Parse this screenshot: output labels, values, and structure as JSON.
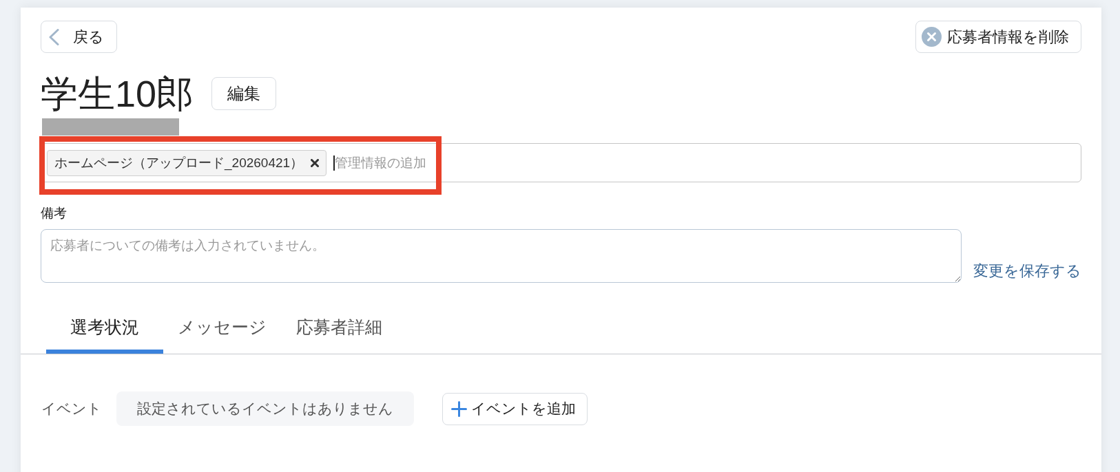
{
  "header": {
    "back_button": "戻る",
    "delete_button": "応募者情報を削除"
  },
  "applicant": {
    "name": "学生10郎",
    "edit_button": "編集"
  },
  "tags": {
    "highlighted": true,
    "focused": true,
    "items": [
      {
        "label": "ホームページ（アップロード_20260421）"
      }
    ],
    "placeholder": "管理情報の追加"
  },
  "notes": {
    "label": "備考",
    "placeholder": "応募者についての備考は入力されていません。",
    "save_link": "変更を保存する"
  },
  "tabs": [
    {
      "label": "選考状況",
      "selected": true
    },
    {
      "label": "メッセージ",
      "selected": false
    },
    {
      "label": "応募者詳細",
      "selected": false
    }
  ],
  "events": {
    "label": "イベント",
    "empty_message": "設定されているイベントはありません",
    "add_button": "イベントを追加"
  }
}
